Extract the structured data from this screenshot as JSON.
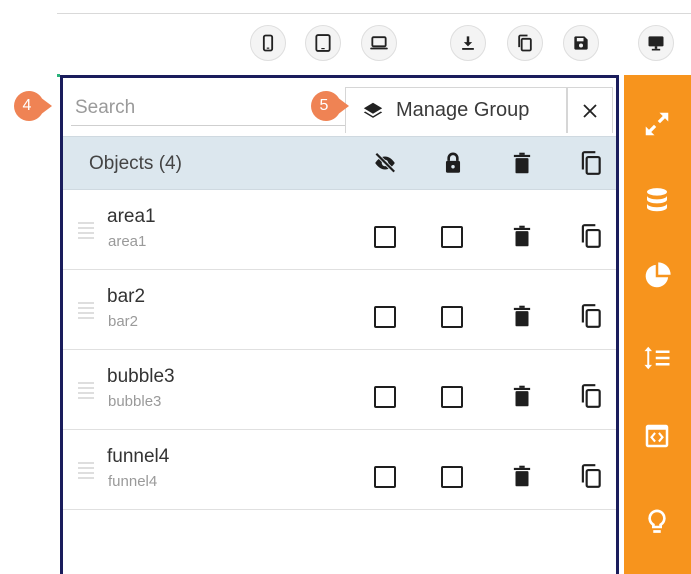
{
  "toolbar": {
    "buttons": [
      {
        "name": "mobile-view-button",
        "icon": "mobile-icon"
      },
      {
        "name": "tablet-view-button",
        "icon": "tablet-icon"
      },
      {
        "name": "laptop-view-button",
        "icon": "laptop-icon"
      },
      {
        "name": "download-button",
        "icon": "download-icon"
      },
      {
        "name": "copy-button",
        "icon": "copy-icon"
      },
      {
        "name": "save-button",
        "icon": "save-icon"
      },
      {
        "name": "desktop-view-button",
        "icon": "desktop-icon"
      }
    ]
  },
  "panel": {
    "search": {
      "placeholder": "Search",
      "value": ""
    },
    "manage_group": {
      "label": "Manage Group",
      "icon": "layers-icon"
    },
    "close": {
      "icon": "close-icon"
    },
    "header": {
      "title": "Objects (4)",
      "icons": [
        "visibility-off-icon",
        "lock-icon",
        "trash-icon",
        "copy-icon"
      ]
    },
    "objects": [
      {
        "name": "area1",
        "subtitle": "area1"
      },
      {
        "name": "bar2",
        "subtitle": "bar2"
      },
      {
        "name": "bubble3",
        "subtitle": "bubble3"
      },
      {
        "name": "funnel4",
        "subtitle": "funnel4"
      }
    ]
  },
  "callouts": [
    {
      "number": "4",
      "target": "search"
    },
    {
      "number": "5",
      "target": "manage-group"
    }
  ],
  "sidebar": {
    "icons": [
      "expand-icon",
      "database-icon",
      "pie-chart-icon",
      "sort-list-icon",
      "code-icon",
      "lightbulb-icon"
    ]
  },
  "colors": {
    "panel_border": "#1a1d5c",
    "header_bg": "#dce7ee",
    "sidebar_bg": "#f7941d",
    "callout_bg": "#ef8354"
  }
}
